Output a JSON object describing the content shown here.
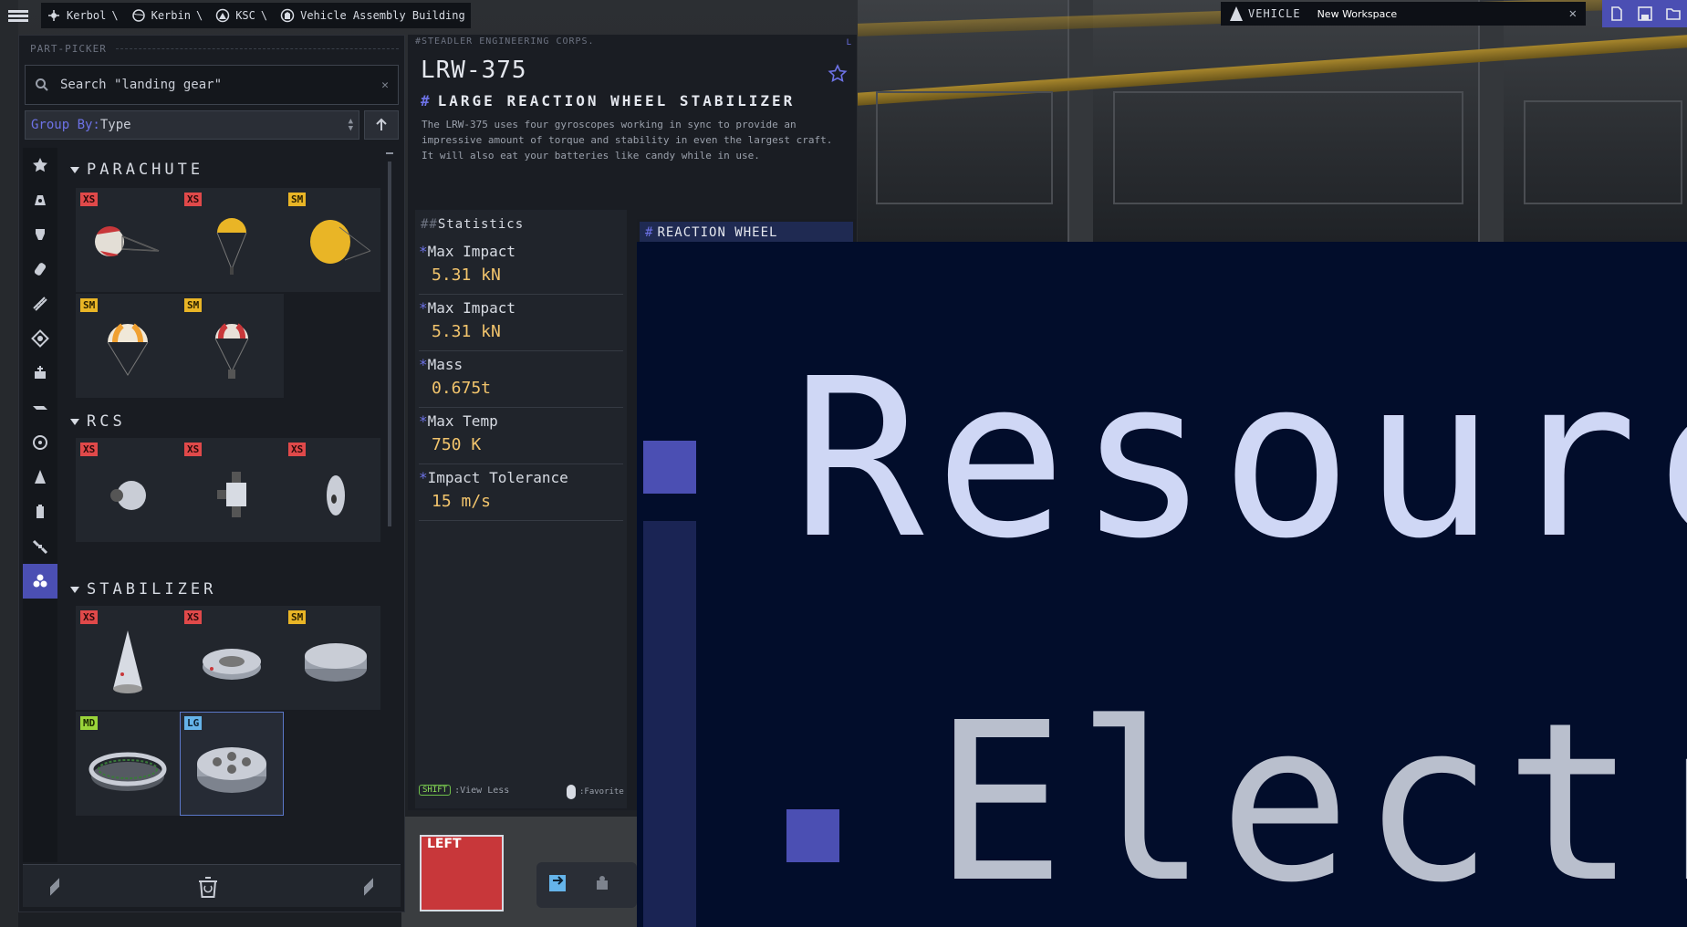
{
  "topbar": {
    "breadcrumbs": [
      "Kerbol",
      "Kerbin",
      "KSC",
      "Vehicle Assembly Building"
    ],
    "vehicle_label": "VEHICLE",
    "workspace_name": "New Workspace"
  },
  "picker": {
    "title": "PART-PICKER",
    "search_value": "Search \"landing gear\"",
    "group_by_key": "Group By:",
    "group_by_value": "Type",
    "groups": [
      {
        "name": "PARACHUTE",
        "items": [
          "XS",
          "XS",
          "SM",
          "SM",
          "SM"
        ]
      },
      {
        "name": "RCS",
        "items": [
          "XS",
          "XS",
          "XS"
        ]
      },
      {
        "name": "STABILIZER",
        "items": [
          "XS",
          "XS",
          "SM",
          "MD",
          "LG"
        ]
      }
    ]
  },
  "details": {
    "manufacturer": "#STEADLER ENGINEERING CORPS.",
    "corner_tag": "L",
    "part_name": "LRW-375",
    "part_title": "LARGE REACTION WHEEL STABILIZER",
    "part_title_hash": "#",
    "description": "The LRW-375 uses four gyroscopes working in sync to provide an impressive amount of torque and stability in even the largest craft. It will also eat your batteries like candy while in use.",
    "stats_heading": "Statistics",
    "stats_hash": "##",
    "stats": [
      {
        "name": "Max Impact",
        "value": "5.31 kN"
      },
      {
        "name": "Max Impact",
        "value": "5.31 kN"
      },
      {
        "name": "Mass",
        "value": "0.675t"
      },
      {
        "name": "Max Temp",
        "value": "750 K"
      },
      {
        "name": "Impact Tolerance",
        "value": "15 m/s"
      }
    ],
    "stat_bullet": "*",
    "shift_key": "SHIFT",
    "shift_action": ":View Less",
    "fav_action": ":Favorite",
    "module_tab": "REACTION WHEEL"
  },
  "overlay": {
    "line1": "Resourc",
    "line2": "Electr"
  },
  "viewcube": {
    "label": "LEFT"
  },
  "colors": {
    "accent": "#4b4fb3",
    "stat_value": "#f2c46c",
    "xs": "#e0494a",
    "sm": "#e9b526",
    "md": "#9ad43a",
    "lg": "#65b4ea"
  }
}
